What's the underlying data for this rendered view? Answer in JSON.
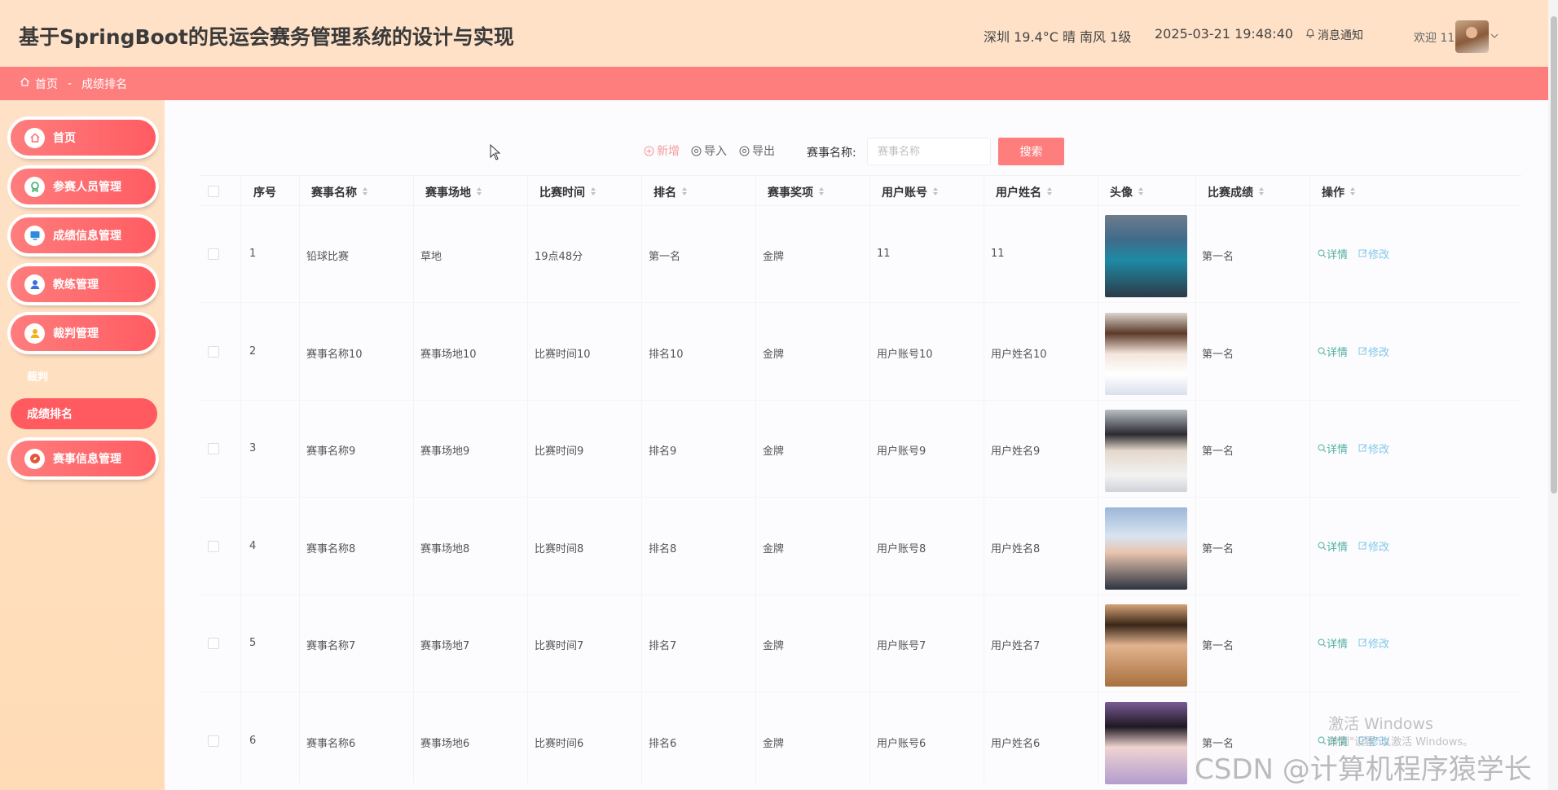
{
  "header": {
    "title": "基于SpringBoot的民运会赛务管理系统的设计与实现",
    "weather": "深圳 19.4°C 晴 南风 1级",
    "datetime": "2025-03-21 19:48:40",
    "notify_label": "消息通知",
    "welcome": "欢迎 11"
  },
  "breadcrumb": {
    "home": "首页",
    "separator": "-",
    "current": "成绩排名"
  },
  "sidebar": {
    "items": [
      {
        "label": "首页",
        "icon": "home-icon"
      },
      {
        "label": "参赛人员管理",
        "icon": "medal-icon"
      },
      {
        "label": "成绩信息管理",
        "icon": "monitor-icon"
      },
      {
        "label": "教练管理",
        "icon": "user-icon"
      },
      {
        "label": "裁判管理",
        "icon": "user-icon"
      },
      {
        "label": "赛事信息管理",
        "icon": "compass-icon"
      }
    ],
    "submenu_label": "裁判",
    "active_item": "成绩排名"
  },
  "toolbar": {
    "add_label": "新增",
    "import_label": "导入",
    "export_label": "导出",
    "search_label": "赛事名称:",
    "search_placeholder": "赛事名称",
    "search_button": "搜索"
  },
  "table": {
    "columns": [
      "序号",
      "赛事名称",
      "赛事场地",
      "比赛时间",
      "排名",
      "赛事奖项",
      "用户账号",
      "用户姓名",
      "头像",
      "比赛成绩",
      "操作"
    ],
    "detail_label": "详情",
    "edit_label": "修改",
    "rows": [
      {
        "no": "1",
        "name": "铅球比赛",
        "venue": "草地",
        "time": "19点48分",
        "rank": "第一名",
        "award": "金牌",
        "account": "11",
        "username": "11",
        "score": "第一名"
      },
      {
        "no": "2",
        "name": "赛事名称10",
        "venue": "赛事场地10",
        "time": "比赛时间10",
        "rank": "排名10",
        "award": "金牌",
        "account": "用户账号10",
        "username": "用户姓名10",
        "score": "第一名"
      },
      {
        "no": "3",
        "name": "赛事名称9",
        "venue": "赛事场地9",
        "time": "比赛时间9",
        "rank": "排名9",
        "award": "金牌",
        "account": "用户账号9",
        "username": "用户姓名9",
        "score": "第一名"
      },
      {
        "no": "4",
        "name": "赛事名称8",
        "venue": "赛事场地8",
        "time": "比赛时间8",
        "rank": "排名8",
        "award": "金牌",
        "account": "用户账号8",
        "username": "用户姓名8",
        "score": "第一名"
      },
      {
        "no": "5",
        "name": "赛事名称7",
        "venue": "赛事场地7",
        "time": "比赛时间7",
        "rank": "排名7",
        "award": "金牌",
        "account": "用户账号7",
        "username": "用户姓名7",
        "score": "第一名"
      },
      {
        "no": "6",
        "name": "赛事名称6",
        "venue": "赛事场地6",
        "time": "比赛时间6",
        "rank": "排名6",
        "award": "金牌",
        "account": "用户账号6",
        "username": "用户姓名6",
        "score": "第一名"
      }
    ]
  },
  "watermarks": {
    "windows_line1": "激活 Windows",
    "windows_line2": "转到\"设置\"以激活 Windows。",
    "csdn": "CSDN @计算机程序猿学长"
  },
  "colors": {
    "header_bg": "#fee1c7",
    "crumb_bg": "#fe7e7e",
    "accent": "#ff5c62",
    "sidebar_bg": "#fee1c7"
  }
}
